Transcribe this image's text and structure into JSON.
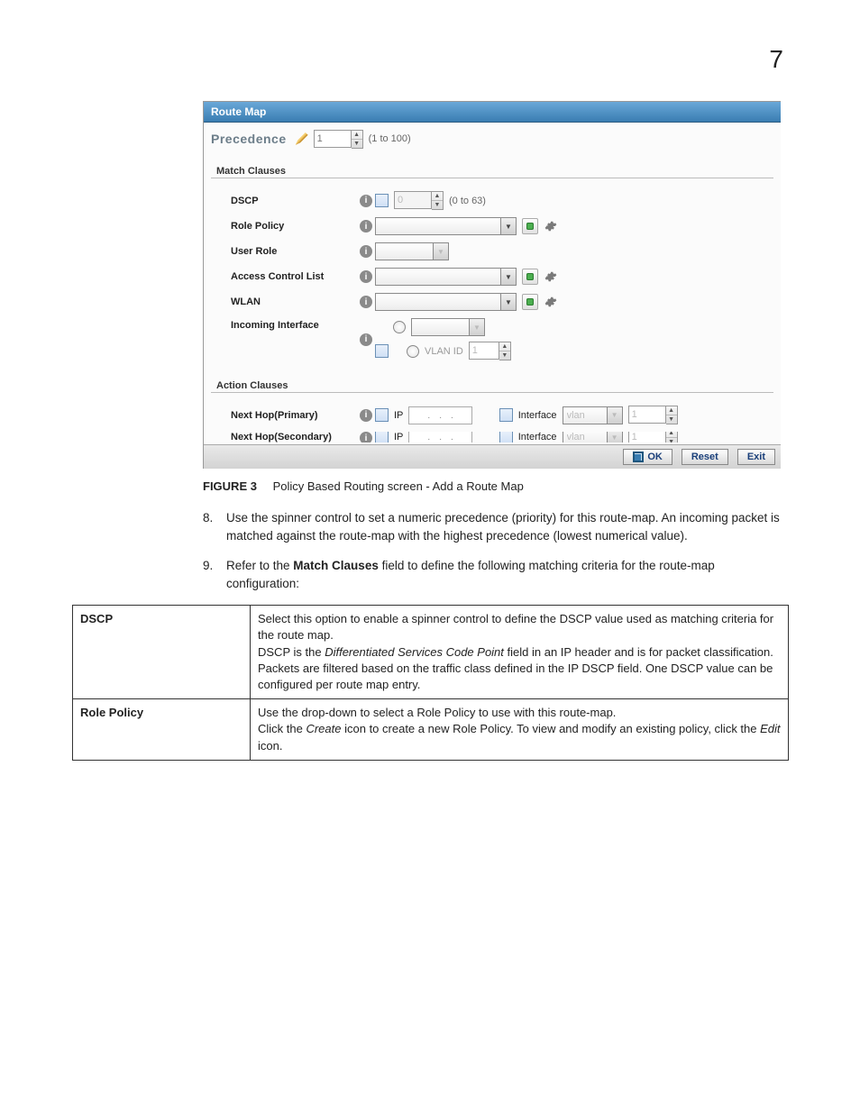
{
  "page_number": "7",
  "screenshot": {
    "panel_title": "Route Map",
    "precedence": {
      "label": "Precedence",
      "value": "1",
      "range": "(1 to 100)"
    },
    "match_clauses": {
      "title": "Match Clauses",
      "dscp": {
        "label": "DSCP",
        "value": "0",
        "range": "(0 to 63)"
      },
      "role_policy": {
        "label": "Role Policy"
      },
      "user_role": {
        "label": "User Role"
      },
      "acl": {
        "label": "Access Control List"
      },
      "wlan": {
        "label": "WLAN"
      },
      "incoming_interface": {
        "label": "Incoming Interface",
        "vlan_id_label": "VLAN ID",
        "vlan_id_value": "1"
      }
    },
    "action_clauses": {
      "title": "Action Clauses",
      "primary": {
        "label": "Next Hop(Primary)",
        "ip_label": "IP",
        "interface_label": "Interface",
        "iface_type": "vlan",
        "iface_val": "1"
      },
      "secondary": {
        "label": "Next Hop(Secondary)",
        "ip_label": "IP",
        "interface_label": "Interface",
        "iface_type": "vlan",
        "iface_val": "1"
      }
    },
    "buttons": {
      "ok": "OK",
      "reset": "Reset",
      "exit": "Exit"
    }
  },
  "figure": {
    "label": "FIGURE 3",
    "caption": "Policy Based Routing screen - Add a Route Map"
  },
  "steps": {
    "s8": {
      "num": "8.",
      "text": "Use the spinner control to set a numeric precedence (priority) for this route-map. An incoming packet is matched against the route-map with the highest precedence (lowest numerical value)."
    },
    "s9": {
      "num": "9.",
      "text_a": "Refer to the ",
      "text_bold": "Match Clauses",
      "text_b": " field to define the following matching criteria for the route-map configuration:"
    }
  },
  "table": {
    "dscp": {
      "name": "DSCP",
      "p1": "Select this option to enable a spinner control to define the DSCP value used as matching criteria for the route map.",
      "p2a": "DSCP is the ",
      "p2i": "Differentiated Services Code Point",
      "p2b": " field in an IP header and is for packet classification. Packets are filtered based on the traffic class defined in the IP DSCP field. One DSCP value can be configured per route map entry."
    },
    "role_policy": {
      "name": "Role Policy",
      "p1": "Use the drop-down to select a Role Policy to use with this route-map.",
      "p2a": "Click the ",
      "p2i1": "Create",
      "p2b": " icon to create a new Role Policy. To view and modify an existing policy, click the ",
      "p2i2": "Edit",
      "p2c": " icon."
    }
  }
}
